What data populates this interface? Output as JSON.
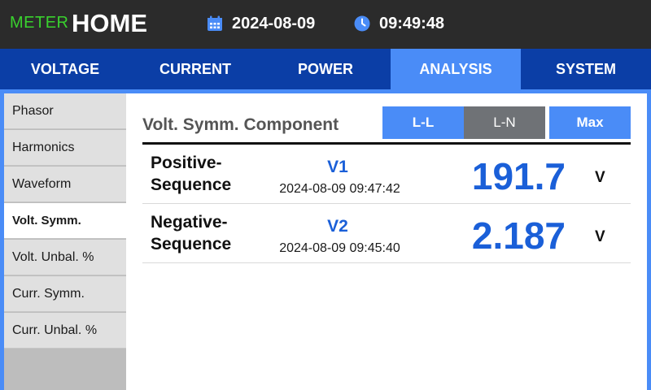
{
  "header": {
    "brand_meter": "METER",
    "brand_home": "HOME",
    "date": "2024-08-09",
    "time": "09:49:48",
    "date_icon": "calendar-icon",
    "time_icon": "clock-icon"
  },
  "tabs": [
    {
      "label": "VOLTAGE",
      "active": false
    },
    {
      "label": "CURRENT",
      "active": false
    },
    {
      "label": "POWER",
      "active": false
    },
    {
      "label": "ANALYSIS",
      "active": true
    },
    {
      "label": "SYSTEM",
      "active": false
    }
  ],
  "sidebar": {
    "items": [
      {
        "label": "Phasor",
        "active": false
      },
      {
        "label": "Harmonics",
        "active": false
      },
      {
        "label": "Waveform",
        "active": false
      },
      {
        "label": "Volt. Symm.",
        "active": true
      },
      {
        "label": "Volt. Unbal. %",
        "active": false
      },
      {
        "label": "Curr. Symm.",
        "active": false
      },
      {
        "label": "Curr. Unbal. %",
        "active": false
      }
    ]
  },
  "main": {
    "title": "Volt. Symm. Component",
    "buttons": {
      "ll": "L-L",
      "ln": "L-N",
      "max": "Max"
    },
    "rows": [
      {
        "label_line1": "Positive-",
        "label_line2": "Sequence",
        "symbol": "V1",
        "timestamp": "2024-08-09 09:47:42",
        "value": "191.7",
        "unit": "V"
      },
      {
        "label_line1": "Negative-",
        "label_line2": "Sequence",
        "symbol": "V2",
        "timestamp": "2024-08-09 09:45:40",
        "value": "2.187",
        "unit": "V"
      }
    ]
  },
  "colors": {
    "brand_green": "#39d12e",
    "tab_bar": "#0b3ea6",
    "accent_blue": "#4a8cf7",
    "value_blue": "#1a5fd8",
    "inactive_button": "#6f7276"
  }
}
